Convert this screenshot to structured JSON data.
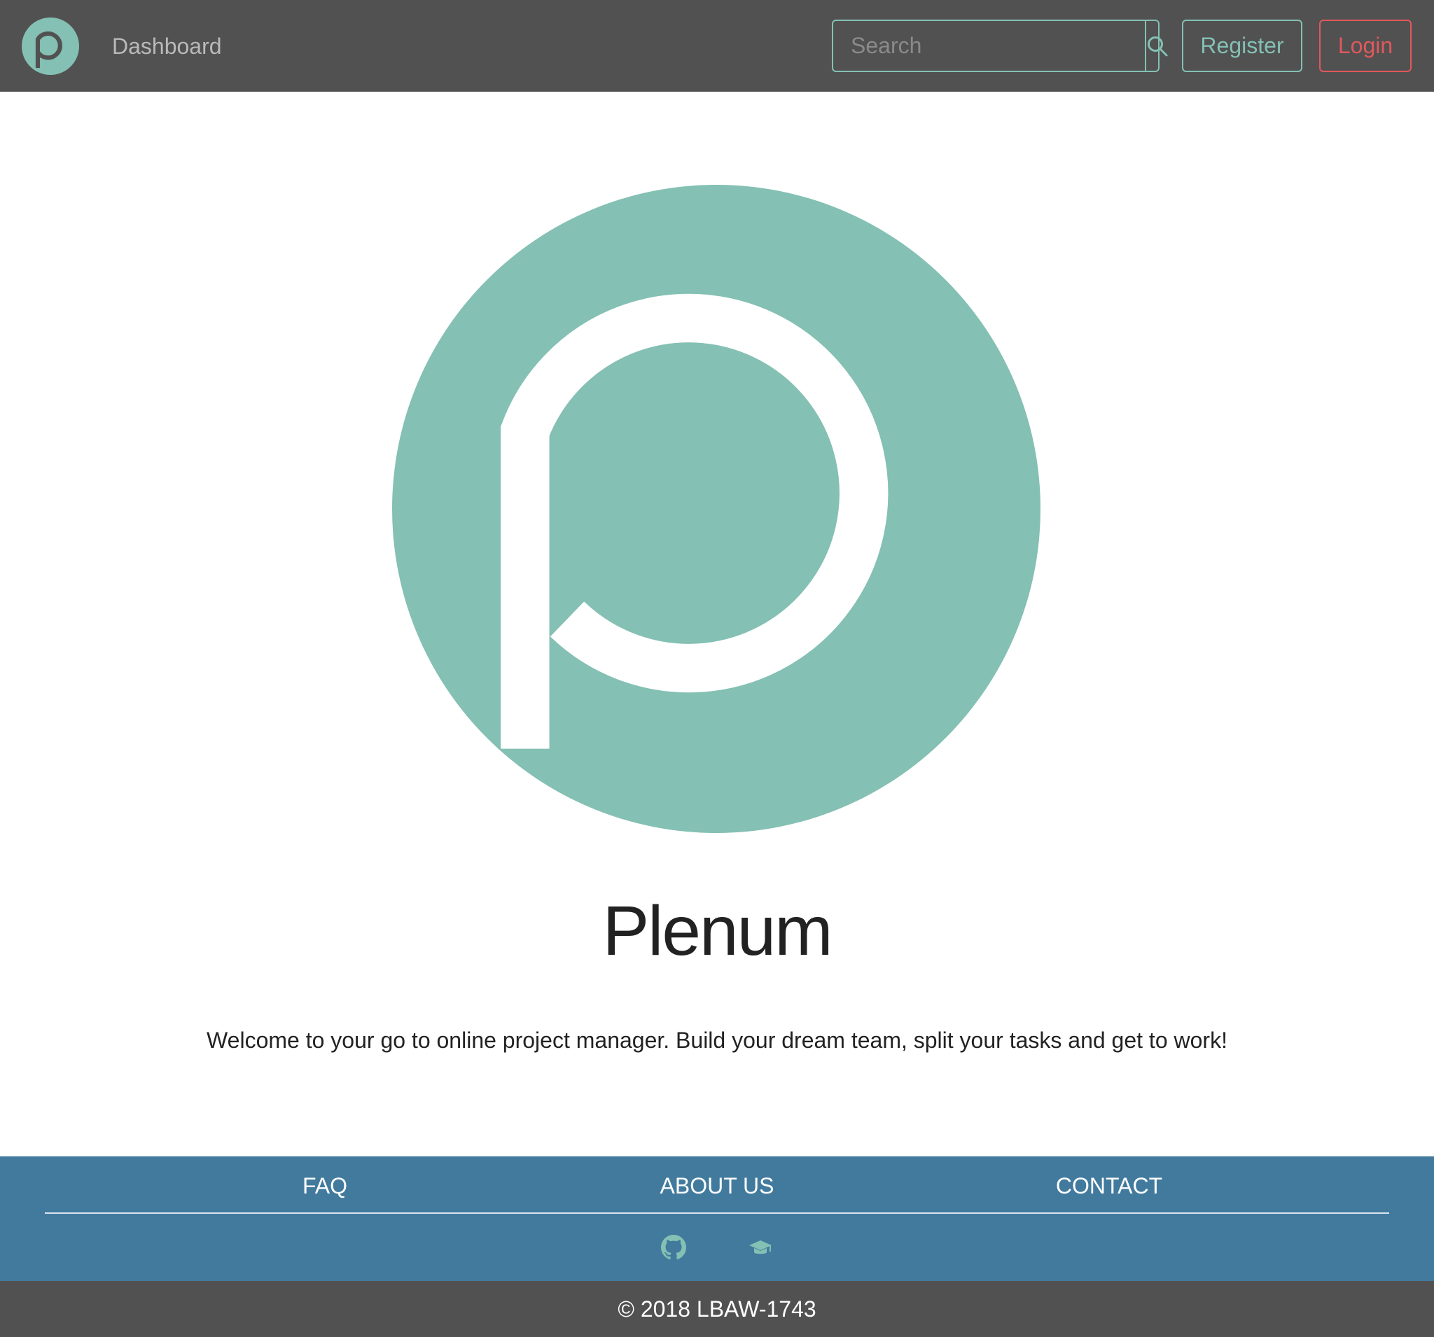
{
  "colors": {
    "brand": "#84c0b3",
    "navbar_bg": "#515151",
    "footer_bg": "#417a9d",
    "login_accent": "#e0585b"
  },
  "navbar": {
    "logo_icon": "plenum-p-logo-icon",
    "dashboard_label": "Dashboard",
    "search": {
      "placeholder": "Search",
      "value": "",
      "button_icon": "search-icon"
    },
    "register_label": "Register",
    "login_label": "Login"
  },
  "hero": {
    "logo_icon": "plenum-p-logo-icon",
    "title": "Plenum",
    "tagline": "Welcome to your go to online project manager. Build your dream team, split your tasks and get to work!"
  },
  "footer": {
    "links": [
      {
        "label": "FAQ"
      },
      {
        "label": "ABOUT US"
      },
      {
        "label": "CONTACT"
      }
    ],
    "icons": [
      "github-icon",
      "graduation-cap-icon"
    ],
    "copyright": "© 2018 LBAW-1743"
  }
}
